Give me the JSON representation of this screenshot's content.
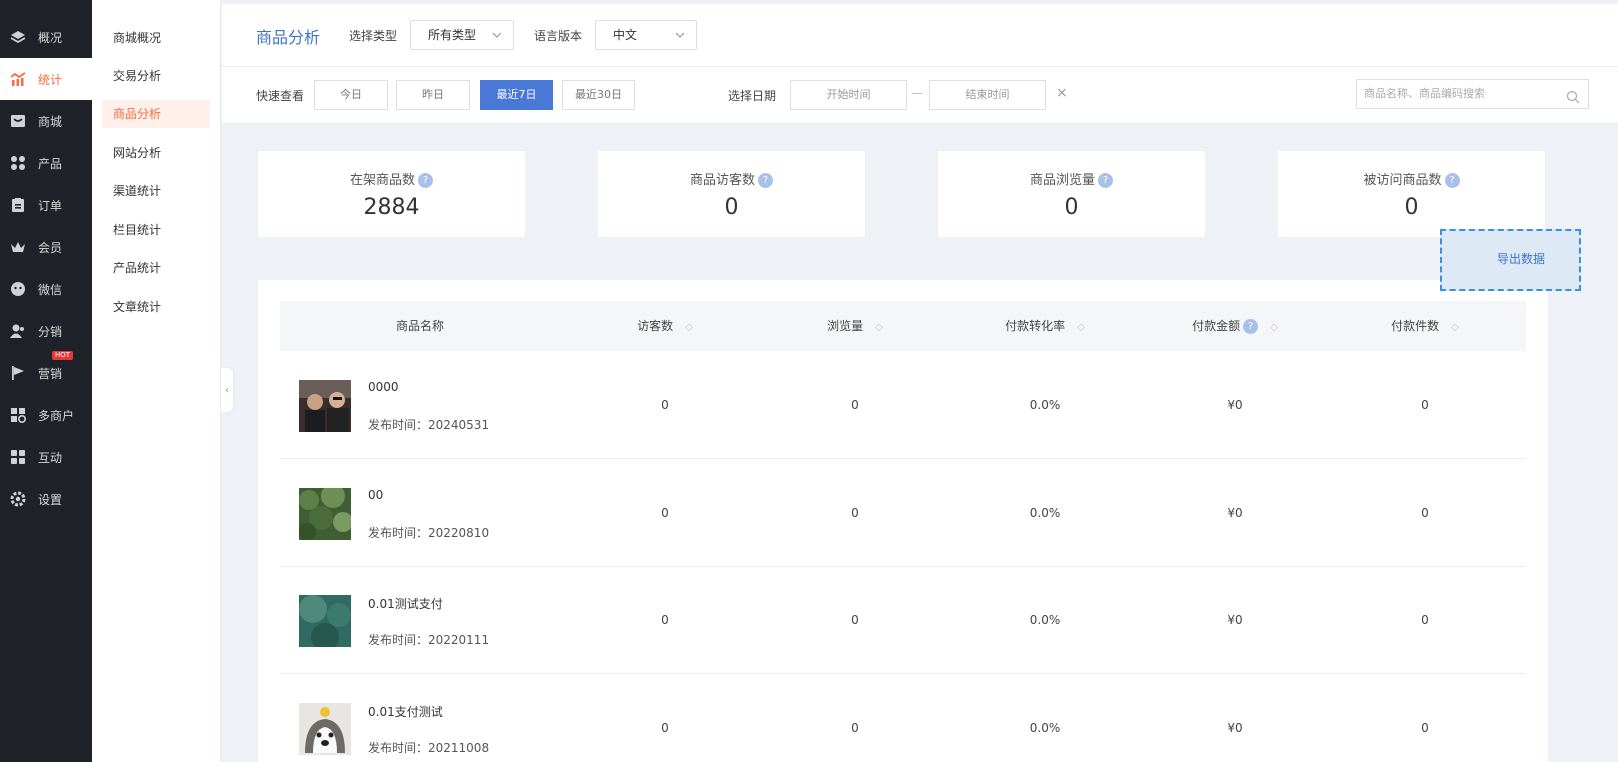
{
  "sidebar": {
    "items": [
      {
        "label": "概况",
        "icon": "layers-icon"
      },
      {
        "label": "统计",
        "icon": "chart-icon"
      },
      {
        "label": "商城",
        "icon": "shop-icon"
      },
      {
        "label": "产品",
        "icon": "grid-icon"
      },
      {
        "label": "订单",
        "icon": "clipboard-icon"
      },
      {
        "label": "会员",
        "icon": "crown-icon"
      },
      {
        "label": "微信",
        "icon": "wechat-icon"
      },
      {
        "label": "分销",
        "icon": "users-icon"
      },
      {
        "label": "营销",
        "icon": "flag-icon",
        "badge": "HOT"
      },
      {
        "label": "多商户",
        "icon": "store-icon"
      },
      {
        "label": "互动",
        "icon": "apps-icon"
      },
      {
        "label": "设置",
        "icon": "gear-icon"
      }
    ],
    "active_index": 1
  },
  "submenu": {
    "items": [
      "商城概况",
      "交易分析",
      "商品分析",
      "网站分析",
      "渠道统计",
      "栏目统计",
      "产品统计",
      "文章统计"
    ],
    "active_index": 2
  },
  "header": {
    "title": "商品分析",
    "type_label": "选择类型",
    "type_value": "所有类型",
    "lang_label": "语言版本",
    "lang_value": "中文"
  },
  "filters": {
    "quick_label": "快速查看",
    "quick_buttons": [
      "今日",
      "昨日",
      "最近7日",
      "最近30日"
    ],
    "active_quick": 2,
    "date_label": "选择日期",
    "start_placeholder": "开始时间",
    "end_placeholder": "结束时间",
    "dash": "—",
    "clear": "×",
    "search_placeholder": "商品名称、商品编码搜索"
  },
  "stats": [
    {
      "title": "在架商品数",
      "value": "2884"
    },
    {
      "title": "商品访客数",
      "value": "0"
    },
    {
      "title": "商品浏览量",
      "value": "0"
    },
    {
      "title": "被访问商品数",
      "value": "0"
    }
  ],
  "help_mark": "?",
  "export_label": "导出数据",
  "table": {
    "columns": [
      {
        "label": "商品名称",
        "sortable": false,
        "help": false
      },
      {
        "label": "访客数",
        "sortable": true,
        "help": false
      },
      {
        "label": "浏览量",
        "sortable": true,
        "help": false
      },
      {
        "label": "付款转化率",
        "sortable": true,
        "help": false
      },
      {
        "label": "付款金额",
        "sortable": true,
        "help": true
      },
      {
        "label": "付款件数",
        "sortable": true,
        "help": false
      }
    ],
    "sort_glyph": "◇",
    "rows": [
      {
        "name": "0000",
        "date": "发布时间：20240531",
        "visitors": "0",
        "views": "0",
        "rate": "0.0%",
        "amount": "¥0",
        "qty": "0",
        "thumb": "photo-two-people"
      },
      {
        "name": "00",
        "date": "发布时间：20220810",
        "visitors": "0",
        "views": "0",
        "rate": "0.0%",
        "amount": "¥0",
        "qty": "0",
        "thumb": "photo-forest"
      },
      {
        "name": "0.01测试支付",
        "date": "发布时间：20220111",
        "visitors": "0",
        "views": "0",
        "rate": "0.0%",
        "amount": "¥0",
        "qty": "0",
        "thumb": "photo-water"
      },
      {
        "name": "0.01支付测试",
        "date": "发布时间：20211008",
        "visitors": "0",
        "views": "0",
        "rate": "0.0%",
        "amount": "¥0",
        "qty": "0",
        "thumb": "photo-dog"
      }
    ]
  },
  "colors": {
    "accent": "#4a78d6",
    "active_orange": "#ff6a3d",
    "sidebar_bg": "#1f2329",
    "title_blue": "#3d74c8"
  }
}
